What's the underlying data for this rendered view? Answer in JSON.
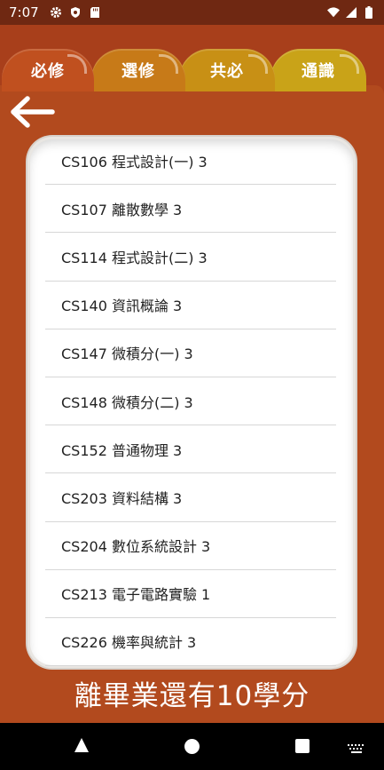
{
  "status_bar": {
    "time": "7:07",
    "left_icons": [
      "gear-icon",
      "shield-icon",
      "sd-card-icon"
    ],
    "right_icons": [
      "wifi-icon",
      "signal-icon",
      "battery-icon"
    ]
  },
  "tabs": [
    {
      "label": "必修"
    },
    {
      "label": "選修"
    },
    {
      "label": "共必"
    },
    {
      "label": "通識"
    }
  ],
  "courses": [
    {
      "label": "CS106 程式設計(一) 3"
    },
    {
      "label": "CS107 離散數學 3"
    },
    {
      "label": "CS114 程式設計(二) 3"
    },
    {
      "label": "CS140 資訊概論 3"
    },
    {
      "label": "CS147 微積分(一) 3"
    },
    {
      "label": "CS148 微積分(二) 3"
    },
    {
      "label": "CS152 普通物理 3"
    },
    {
      "label": "CS203 資料結構 3"
    },
    {
      "label": "CS204 數位系統設計 3"
    },
    {
      "label": "CS213 電子電路實驗 1"
    },
    {
      "label": "CS226 機率與統計 3"
    }
  ],
  "footer": {
    "remaining_text": "離畢業還有10學分"
  },
  "colors": {
    "status_bar": "#6f2812",
    "background": "#a83f1b",
    "tab_1": "#c0501f",
    "tab_2": "#c77a18",
    "tab_3": "#c89015",
    "tab_4": "#c9a318"
  }
}
